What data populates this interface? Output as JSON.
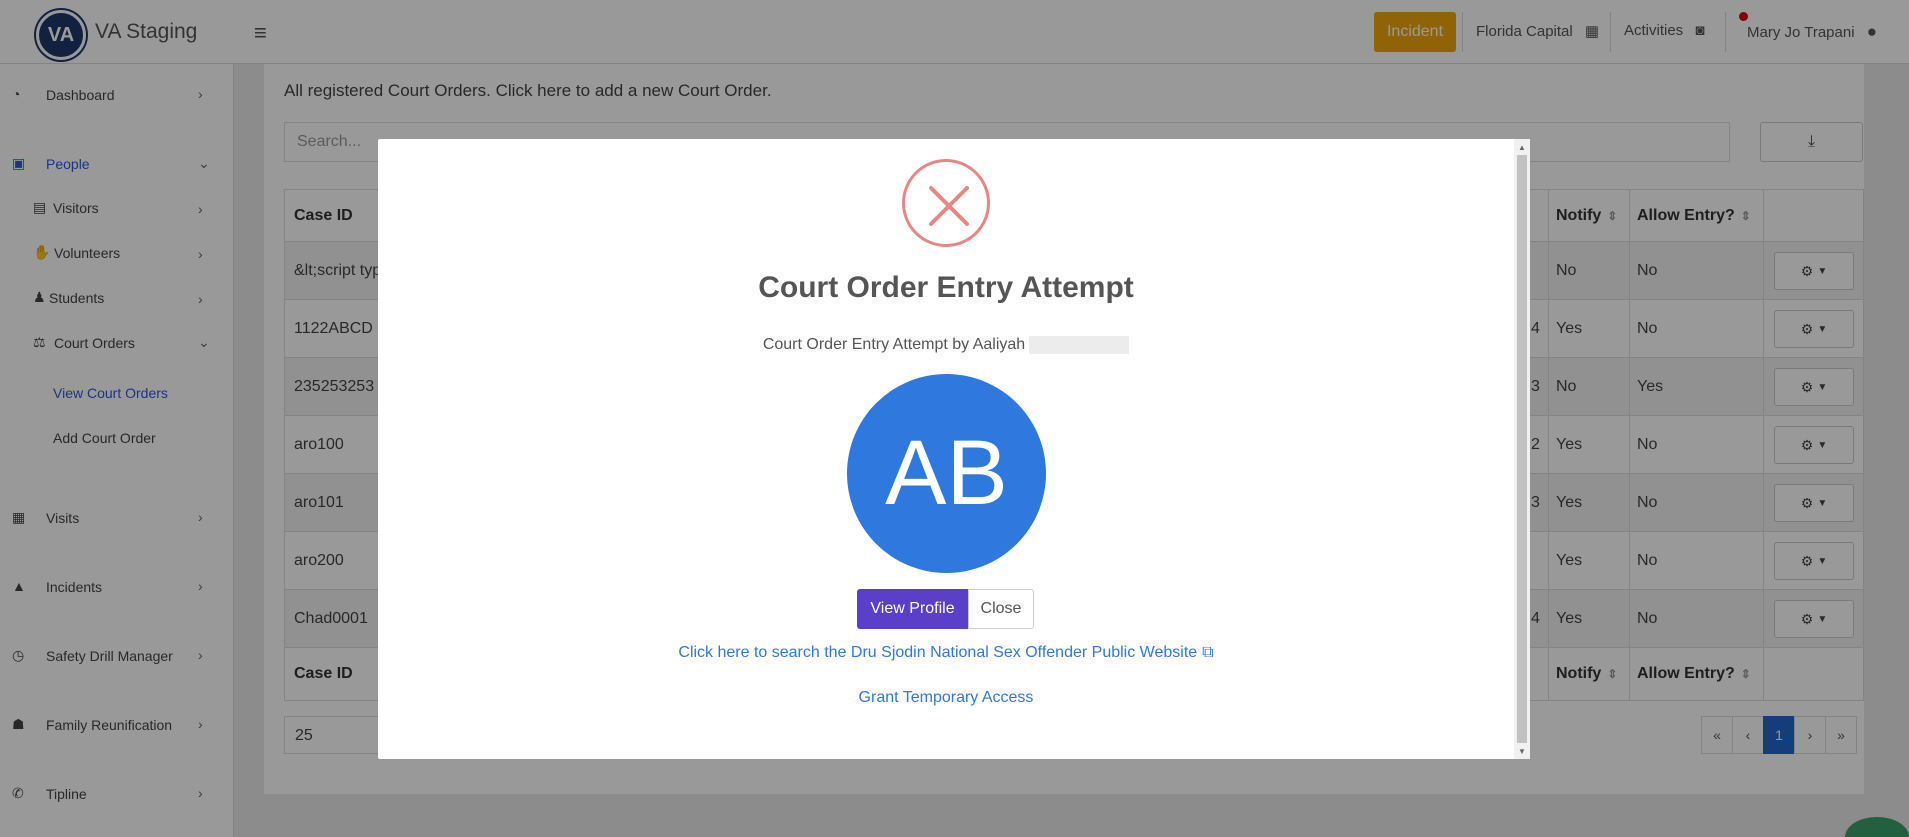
{
  "header": {
    "app_title": "VA Staging",
    "logo_text": "VA",
    "incident_label": "Incident",
    "location_label": "Florida Capital",
    "activities_label": "Activities",
    "user_name": "Mary Jo Trapani"
  },
  "sidebar": {
    "items": [
      {
        "label": "Dashboard"
      },
      {
        "label": "People"
      },
      {
        "label": "Visitors"
      },
      {
        "label": "Volunteers"
      },
      {
        "label": "Students"
      },
      {
        "label": "Court Orders"
      },
      {
        "label": "View Court Orders"
      },
      {
        "label": "Add Court Order"
      },
      {
        "label": "Visits"
      },
      {
        "label": "Incidents"
      },
      {
        "label": "Safety Drill Manager"
      },
      {
        "label": "Family Reunification"
      },
      {
        "label": "Tipline"
      }
    ]
  },
  "main": {
    "intro": "All registered Court Orders. Click here to add a new Court Order.",
    "search_placeholder": "Search...",
    "columns": {
      "case_id": "Case ID",
      "notify": "Notify",
      "allow_entry": "Allow Entry?"
    },
    "rows": [
      {
        "case_id": "&lt;script typ",
        "mid": "",
        "notify": "No",
        "allow": "No"
      },
      {
        "case_id": "1122ABCD",
        "mid": "4",
        "notify": "Yes",
        "allow": "No"
      },
      {
        "case_id": "235253253",
        "mid": "3",
        "notify": "No",
        "allow": "Yes"
      },
      {
        "case_id": "aro100",
        "mid": "2",
        "notify": "Yes",
        "allow": "No"
      },
      {
        "case_id": "aro101",
        "mid": "3",
        "notify": "Yes",
        "allow": "No"
      },
      {
        "case_id": "aro200",
        "mid": "",
        "notify": "Yes",
        "allow": "No"
      },
      {
        "case_id": "Chad0001",
        "mid": "4",
        "notify": "Yes",
        "allow": "No"
      }
    ],
    "page_size": "25",
    "pager": [
      "«",
      "‹",
      "1",
      "›",
      "»"
    ]
  },
  "modal": {
    "title": "Court Order Entry Attempt",
    "subtitle": "Court Order Entry Attempt by Aaliyah",
    "avatar_initials": "AB",
    "view_profile_label": "View Profile",
    "close_label": "Close",
    "link_sex_offender": "Click here to search the Dru Sjodin National Sex Offender Public Website",
    "link_temp_access": "Grant Temporary Access"
  },
  "colors": {
    "incident": "#f0a70b",
    "primary": "#5a3fc8",
    "link": "#2f78dd",
    "error": "#e88585"
  }
}
